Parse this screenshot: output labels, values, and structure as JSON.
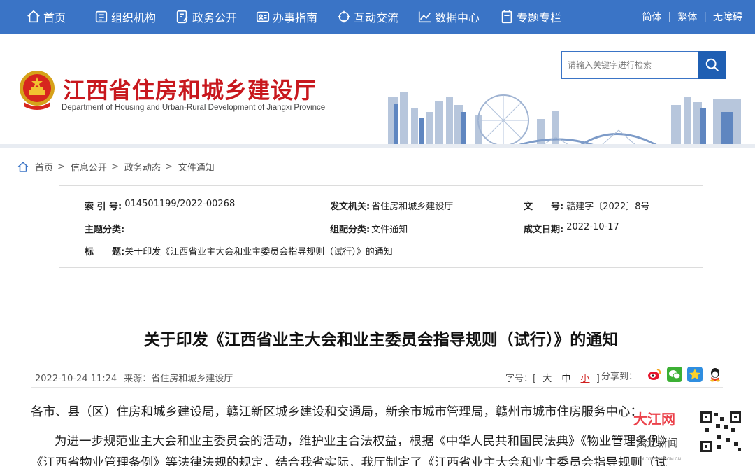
{
  "nav": {
    "items": [
      {
        "label": "首页",
        "icon": "home-icon"
      },
      {
        "label": "组织机构",
        "icon": "org-icon"
      },
      {
        "label": "政务公开",
        "icon": "document-icon"
      },
      {
        "label": "办事指南",
        "icon": "id-card-icon"
      },
      {
        "label": "互动交流",
        "icon": "interaction-icon"
      },
      {
        "label": "数据中心",
        "icon": "chart-icon"
      },
      {
        "label": "专题专栏",
        "icon": "topic-icon"
      }
    ],
    "lang": {
      "simplified": "简体",
      "traditional": "繁体",
      "accessible": "无障碍"
    }
  },
  "header": {
    "title": "江西省住房和城乡建设厅",
    "subtitle": "Department of Housing and Urban-Rural Development of Jiangxi Province",
    "search_placeholder": "请输入关键字进行检索"
  },
  "breadcrumb": [
    "首页",
    "信息公开",
    "政务动态",
    "文件通知"
  ],
  "info": {
    "index_label": "索 引 号:",
    "index_value": "014501199/2022-00268",
    "issuer_label": "发文机关:",
    "issuer_value": "省住房和城乡建设厅",
    "docno_label": "文　　号:",
    "docno_value": "赣建字〔2022〕8号",
    "theme_label": "主题分类:",
    "theme_value": "",
    "category_label": "组配分类:",
    "category_value": "文件通知",
    "date_label": "成文日期:",
    "date_value": "2022-10-17",
    "subject_label": "标　　题:",
    "subject_value": "关于印发《江西省业主大会和业主委员会指导规则（试行）》的通知"
  },
  "article": {
    "title": "关于印发《江西省业主大会和业主委员会指导规则（试行）》的通知",
    "datetime": "2022-10-24 11:24",
    "source": "来源：省住房和城乡建设厅",
    "fontsize_label": "字号：[",
    "size_large": "大",
    "size_medium": "中",
    "size_small": "小",
    "fontsize_close": "]",
    "share_label": "分享到：",
    "para1": "各市、县（区）住房和城乡建设局，赣江新区城乡建设和交通局，新余市城市管理局，赣州市城市住房服务中心：",
    "para2": "为进一步规范业主大会和业主委员会的活动，维护业主合法权益，根据《中华人民共和国民法典》《物业管理条例》",
    "para3": "《江西省物业管理条例》等法律法规的规定，结合我省实际，我厅制定了《江西省业主大会和业主委员会指导规则（试"
  },
  "watermark": {
    "brand": "大江网",
    "sub": "大江新闻",
    "url": "TT.M.JXNEWS.COM.CN"
  },
  "colors": {
    "nav_bg": "#3a74c6",
    "title_red": "#c8181e",
    "accent_red": "#d0201f"
  }
}
